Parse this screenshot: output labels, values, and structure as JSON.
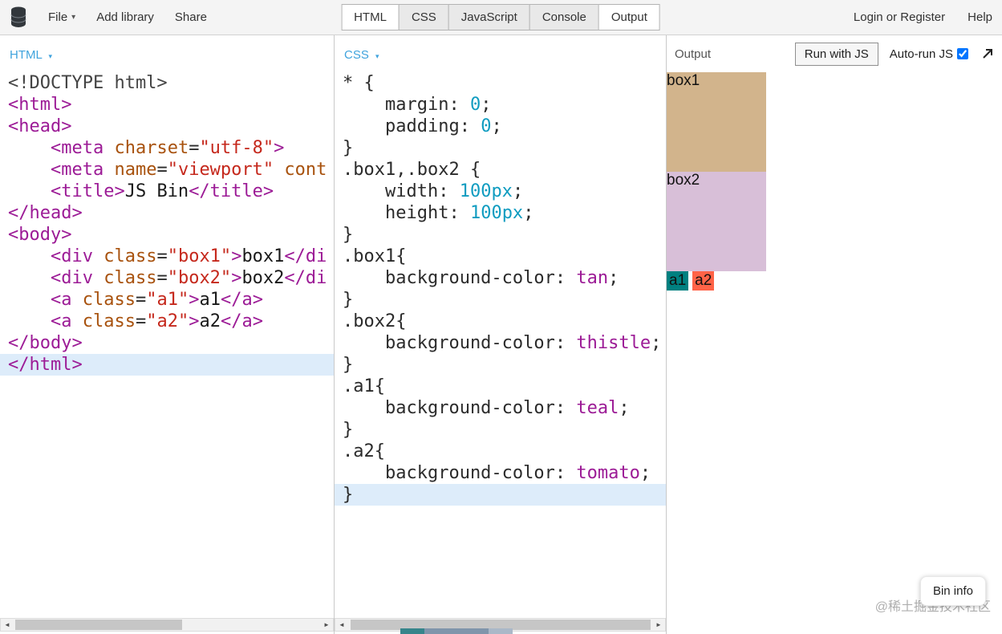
{
  "toolbar": {
    "file_label": "File",
    "add_library_label": "Add library",
    "share_label": "Share",
    "login_label": "Login or Register",
    "help_label": "Help",
    "tabs": [
      {
        "label": "HTML",
        "active": true
      },
      {
        "label": "CSS",
        "active": false
      },
      {
        "label": "JavaScript",
        "active": false
      },
      {
        "label": "Console",
        "active": false
      },
      {
        "label": "Output",
        "active": true
      }
    ]
  },
  "icons": {
    "caret_down": "▾",
    "scroll_left": "◄",
    "scroll_right": "►"
  },
  "editors": {
    "html": {
      "header": "HTML",
      "lines": [
        {
          "tk": [
            {
              "t": "meta",
              "s": "<!DOCTYPE html>"
            }
          ]
        },
        {
          "tk": [
            {
              "t": "tag",
              "s": "<html>"
            }
          ]
        },
        {
          "tk": [
            {
              "t": "tag",
              "s": "<head>"
            }
          ]
        },
        {
          "tk": [
            {
              "t": "pl",
              "s": "    "
            },
            {
              "t": "tag",
              "s": "<meta "
            },
            {
              "t": "attr",
              "s": "charset"
            },
            {
              "t": "pl",
              "s": "="
            },
            {
              "t": "str",
              "s": "\"utf-8\""
            },
            {
              "t": "tag",
              "s": ">"
            }
          ]
        },
        {
          "tk": [
            {
              "t": "pl",
              "s": "    "
            },
            {
              "t": "tag",
              "s": "<meta "
            },
            {
              "t": "attr",
              "s": "name"
            },
            {
              "t": "pl",
              "s": "="
            },
            {
              "t": "str",
              "s": "\"viewport\""
            },
            {
              "t": "pl",
              "s": " "
            },
            {
              "t": "attr",
              "s": "cont"
            }
          ]
        },
        {
          "tk": [
            {
              "t": "pl",
              "s": "    "
            },
            {
              "t": "tag",
              "s": "<title>"
            },
            {
              "t": "txt",
              "s": "JS Bin"
            },
            {
              "t": "tag",
              "s": "</title>"
            }
          ]
        },
        {
          "tk": [
            {
              "t": "tag",
              "s": "</head>"
            }
          ]
        },
        {
          "tk": [
            {
              "t": "tag",
              "s": "<body>"
            }
          ]
        },
        {
          "tk": [
            {
              "t": "pl",
              "s": "    "
            },
            {
              "t": "tag",
              "s": "<div "
            },
            {
              "t": "attr",
              "s": "class"
            },
            {
              "t": "pl",
              "s": "="
            },
            {
              "t": "str",
              "s": "\"box1\""
            },
            {
              "t": "tag",
              "s": ">"
            },
            {
              "t": "txt",
              "s": "box1"
            },
            {
              "t": "tag",
              "s": "</di"
            }
          ]
        },
        {
          "tk": [
            {
              "t": "pl",
              "s": "    "
            },
            {
              "t": "tag",
              "s": "<div "
            },
            {
              "t": "attr",
              "s": "class"
            },
            {
              "t": "pl",
              "s": "="
            },
            {
              "t": "str",
              "s": "\"box2\""
            },
            {
              "t": "tag",
              "s": ">"
            },
            {
              "t": "txt",
              "s": "box2"
            },
            {
              "t": "tag",
              "s": "</di"
            }
          ]
        },
        {
          "tk": [
            {
              "t": "pl",
              "s": "    "
            },
            {
              "t": "tag",
              "s": "<a "
            },
            {
              "t": "attr",
              "s": "class"
            },
            {
              "t": "pl",
              "s": "="
            },
            {
              "t": "str",
              "s": "\"a1\""
            },
            {
              "t": "tag",
              "s": ">"
            },
            {
              "t": "txt",
              "s": "a1"
            },
            {
              "t": "tag",
              "s": "</a>"
            }
          ]
        },
        {
          "tk": [
            {
              "t": "pl",
              "s": "    "
            },
            {
              "t": "tag",
              "s": "<a "
            },
            {
              "t": "attr",
              "s": "class"
            },
            {
              "t": "pl",
              "s": "="
            },
            {
              "t": "str",
              "s": "\"a2\""
            },
            {
              "t": "tag",
              "s": ">"
            },
            {
              "t": "txt",
              "s": "a2"
            },
            {
              "t": "tag",
              "s": "</a>"
            }
          ]
        },
        {
          "tk": [
            {
              "t": "tag",
              "s": "</body>"
            }
          ]
        },
        {
          "tk": [
            {
              "t": "tag",
              "s": "</html>"
            }
          ],
          "hl": true
        }
      ]
    },
    "css": {
      "header": "CSS",
      "lines": [
        {
          "tk": [
            {
              "t": "pl",
              "s": "* {"
            }
          ]
        },
        {
          "tk": [
            {
              "t": "pl",
              "s": "    margin: "
            },
            {
              "t": "num",
              "s": "0"
            },
            {
              "t": "pl",
              "s": ";"
            }
          ]
        },
        {
          "tk": [
            {
              "t": "pl",
              "s": "    padding: "
            },
            {
              "t": "num",
              "s": "0"
            },
            {
              "t": "pl",
              "s": ";"
            }
          ]
        },
        {
          "tk": [
            {
              "t": "pl",
              "s": "}"
            }
          ]
        },
        {
          "tk": [
            {
              "t": "pl",
              "s": ".box1,.box2 {"
            }
          ]
        },
        {
          "tk": [
            {
              "t": "pl",
              "s": "    width: "
            },
            {
              "t": "num",
              "s": "100px"
            },
            {
              "t": "pl",
              "s": ";"
            }
          ]
        },
        {
          "tk": [
            {
              "t": "pl",
              "s": "    height: "
            },
            {
              "t": "num",
              "s": "100px"
            },
            {
              "t": "pl",
              "s": ";"
            }
          ]
        },
        {
          "tk": [
            {
              "t": "pl",
              "s": "}"
            }
          ]
        },
        {
          "tk": [
            {
              "t": "pl",
              "s": ".box1{"
            }
          ]
        },
        {
          "tk": [
            {
              "t": "pl",
              "s": "    background-color: "
            },
            {
              "t": "kw",
              "s": "tan"
            },
            {
              "t": "pl",
              "s": ";"
            }
          ]
        },
        {
          "tk": [
            {
              "t": "pl",
              "s": "}"
            }
          ]
        },
        {
          "tk": [
            {
              "t": "pl",
              "s": ".box2{"
            }
          ]
        },
        {
          "tk": [
            {
              "t": "pl",
              "s": "    background-color: "
            },
            {
              "t": "kw",
              "s": "thistle"
            },
            {
              "t": "pl",
              "s": ";"
            }
          ]
        },
        {
          "tk": [
            {
              "t": "pl",
              "s": "}"
            }
          ]
        },
        {
          "tk": [
            {
              "t": "pl",
              "s": ".a1{"
            }
          ]
        },
        {
          "tk": [
            {
              "t": "pl",
              "s": "    background-color: "
            },
            {
              "t": "kw",
              "s": "teal"
            },
            {
              "t": "pl",
              "s": ";"
            }
          ]
        },
        {
          "tk": [
            {
              "t": "pl",
              "s": "}"
            }
          ]
        },
        {
          "tk": [
            {
              "t": "pl",
              "s": ".a2{"
            }
          ]
        },
        {
          "tk": [
            {
              "t": "pl",
              "s": "    background-color: "
            },
            {
              "t": "kw",
              "s": "tomato"
            },
            {
              "t": "pl",
              "s": ";"
            }
          ]
        },
        {
          "tk": [
            {
              "t": "pl",
              "s": "}"
            }
          ],
          "hl": true
        }
      ]
    }
  },
  "output": {
    "header_label": "Output",
    "run_button": "Run with JS",
    "autorun_label": "Auto-run JS",
    "autorun_checked": true,
    "boxes": [
      {
        "label": "box1",
        "color": "#d2b48c"
      },
      {
        "label": "box2",
        "color": "#d8bfd8"
      }
    ],
    "links": [
      {
        "label": "a1",
        "color": "#008080"
      },
      {
        "label": "a2",
        "color": "#ff6347"
      }
    ],
    "bin_info_label": "Bin info",
    "watermark": "@稀土掘金技术社区"
  }
}
